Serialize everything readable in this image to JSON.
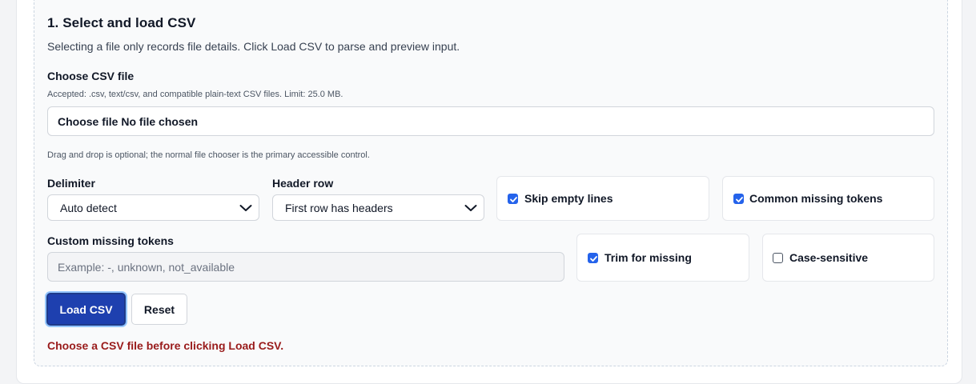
{
  "section": {
    "title": "1. Select and load CSV",
    "description": "Selecting a file only records file details. Click Load CSV to parse and preview input."
  },
  "file": {
    "label": "Choose CSV file",
    "accepted_hint": "Accepted: .csv, text/csv, and compatible plain-text CSV files. Limit: 25.0 MB.",
    "button_label": "Choose file",
    "status": "No file chosen",
    "dragdrop_hint": "Drag and drop is optional; the normal file chooser is the primary accessible control."
  },
  "delimiter": {
    "label": "Delimiter",
    "value": "Auto detect"
  },
  "header_row": {
    "label": "Header row",
    "value": "First row has headers"
  },
  "options": {
    "skip_empty_lines": {
      "label": "Skip empty lines",
      "checked": true
    },
    "common_missing_tokens": {
      "label": "Common missing tokens",
      "checked": true
    },
    "trim_for_missing": {
      "label": "Trim for missing",
      "checked": true
    },
    "case_sensitive": {
      "label": "Case-sensitive",
      "checked": false
    }
  },
  "custom_missing": {
    "label": "Custom missing tokens",
    "placeholder": "Example: -, unknown, not_available",
    "value": ""
  },
  "actions": {
    "load_label": "Load CSV",
    "reset_label": "Reset"
  },
  "error": {
    "message": "Choose a CSV file before clicking Load CSV."
  },
  "colors": {
    "primary": "#1e40af",
    "checkbox": "#2563eb",
    "error": "#991b1b"
  }
}
